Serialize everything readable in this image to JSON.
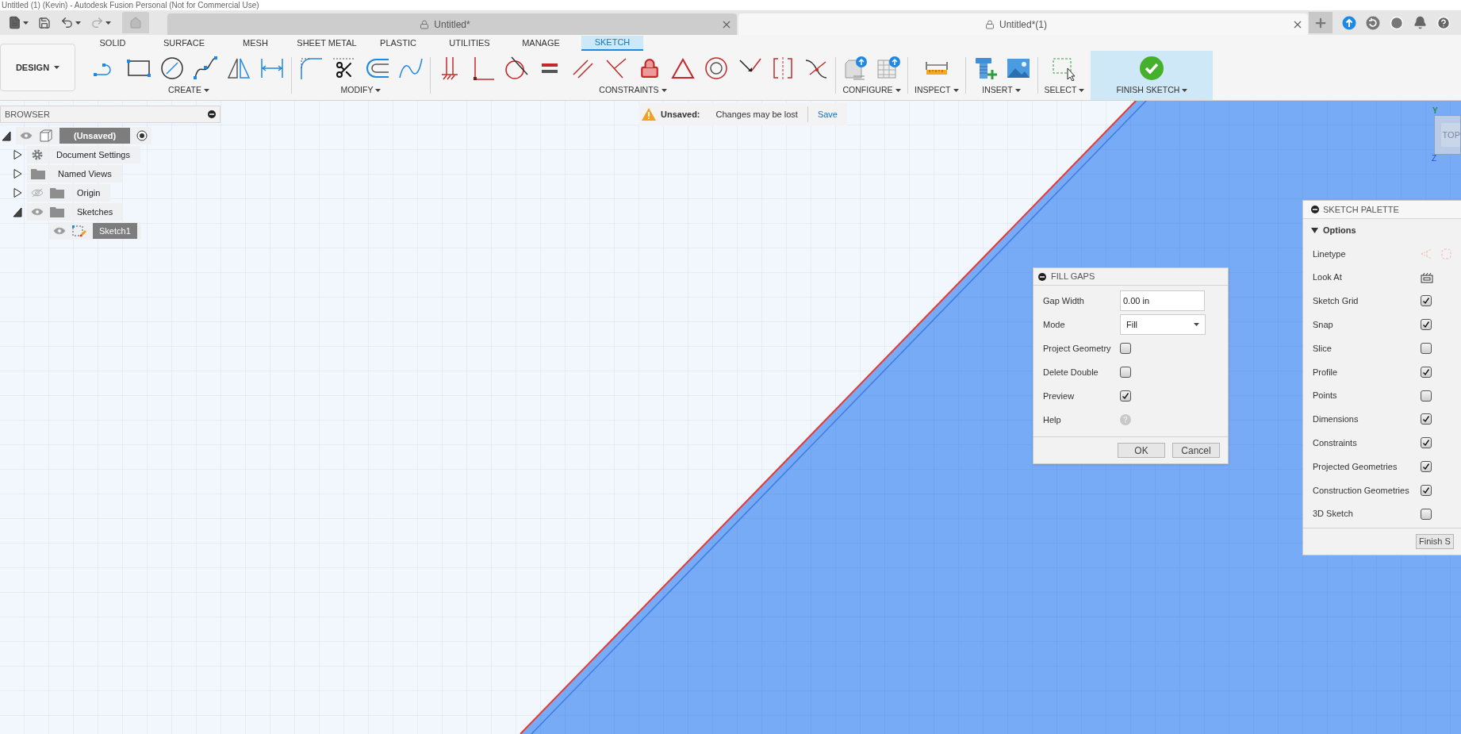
{
  "window": {
    "title": "Untitled (1) (Kevin) - Autodesk Fusion Personal (Not for Commercial Use)"
  },
  "document_tabs": [
    {
      "label": "Untitled*",
      "selected": false
    },
    {
      "label": "Untitled*(1)",
      "selected": true
    }
  ],
  "workspace": {
    "label": "DESIGN"
  },
  "ribbon_tabs": [
    {
      "label": "SOLID",
      "selected": false
    },
    {
      "label": "SURFACE",
      "selected": false
    },
    {
      "label": "MESH",
      "selected": false
    },
    {
      "label": "SHEET METAL",
      "selected": false
    },
    {
      "label": "PLASTIC",
      "selected": false
    },
    {
      "label": "UTILITIES",
      "selected": false
    },
    {
      "label": "MANAGE",
      "selected": false
    },
    {
      "label": "SKETCH",
      "selected": true
    }
  ],
  "tool_groups": [
    {
      "label": "CREATE",
      "kind": "tools"
    },
    {
      "label": "MODIFY",
      "kind": "tools"
    },
    {
      "label": "CONSTRAINTS",
      "kind": "tools"
    },
    {
      "label": "CONFIGURE",
      "kind": "tools"
    },
    {
      "label": "INSPECT",
      "kind": "tools"
    },
    {
      "label": "INSERT",
      "kind": "tools"
    },
    {
      "label": "SELECT",
      "kind": "tools"
    },
    {
      "label": "FINISH SKETCH",
      "kind": "finish"
    }
  ],
  "browser": {
    "title": "BROWSER",
    "tree": [
      {
        "label": "(Unsaved)",
        "kind": "component",
        "visible": true,
        "expanded": true,
        "active": true,
        "children": [
          {
            "label": "Document Settings",
            "kind": "settings",
            "expanded": false,
            "active": false
          },
          {
            "label": "Named Views",
            "kind": "folder",
            "expanded": false,
            "active": false
          },
          {
            "label": "Origin",
            "kind": "folder",
            "visible": false,
            "expanded": false,
            "active": false
          },
          {
            "label": "Sketches",
            "kind": "folder",
            "visible": true,
            "expanded": true,
            "active": false,
            "children": [
              {
                "label": "Sketch1",
                "kind": "sketch",
                "visible": true,
                "active": true
              }
            ]
          }
        ]
      }
    ]
  },
  "notice": {
    "label": "Unsaved:",
    "message": "Changes may be lost",
    "action": "Save"
  },
  "view_cube": {
    "face": "TOP",
    "axes": [
      "Y",
      "Z"
    ]
  },
  "fill_gaps": {
    "title": "FILL GAPS",
    "fields": [
      {
        "kind": "text",
        "label": "Gap Width",
        "value": "0.00 in"
      },
      {
        "kind": "select",
        "label": "Mode",
        "value": "Fill"
      },
      {
        "kind": "checkbox",
        "label": "Project Geometry",
        "checked": false
      },
      {
        "kind": "checkbox",
        "label": "Delete Double",
        "checked": false
      },
      {
        "kind": "checkbox",
        "label": "Preview",
        "checked": true
      },
      {
        "kind": "help",
        "label": "Help"
      }
    ],
    "buttons": [
      "OK",
      "Cancel"
    ]
  },
  "sketch_palette": {
    "title": "SKETCH PALETTE",
    "section": {
      "label": "Options",
      "expanded": true
    },
    "options": [
      {
        "kind": "linetype",
        "label": "Linetype"
      },
      {
        "kind": "look",
        "label": "Look At"
      },
      {
        "kind": "checkbox",
        "label": "Sketch Grid",
        "checked": true
      },
      {
        "kind": "checkbox",
        "label": "Snap",
        "checked": true
      },
      {
        "kind": "checkbox",
        "label": "Slice",
        "checked": false
      },
      {
        "kind": "checkbox",
        "label": "Profile",
        "checked": true
      },
      {
        "kind": "checkbox",
        "label": "Points",
        "checked": false
      },
      {
        "kind": "checkbox",
        "label": "Dimensions",
        "checked": true
      },
      {
        "kind": "checkbox",
        "label": "Constraints",
        "checked": true
      },
      {
        "kind": "checkbox",
        "label": "Projected Geometries",
        "checked": true
      },
      {
        "kind": "checkbox",
        "label": "Construction Geometries",
        "checked": true
      },
      {
        "kind": "checkbox",
        "label": "3D Sketch",
        "checked": false
      }
    ],
    "button": "Finish S"
  }
}
